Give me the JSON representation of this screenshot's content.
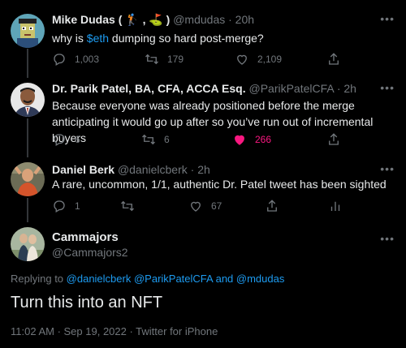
{
  "tweets": [
    {
      "name": "Mike Dudas ( 🏌 , ⛳ )",
      "handle": "@mdudas · 20h",
      "text_before": "why is ",
      "cashtag": "$eth",
      "text_after": " dumping so hard post-merge?",
      "replies": "1,003",
      "retweets": "179",
      "likes": "2,109"
    },
    {
      "name": "Dr. Parik Patel, BA, CFA, ACCA Esq.",
      "handle": "@ParikPatelCFA · 2h",
      "text": "Because everyone was already positioned before the merge anticipating it would go up after so you’ve run out of incremental buyers",
      "replies": "6",
      "retweets": "6",
      "likes": "266"
    },
    {
      "name": "Daniel Berk",
      "handle": "@danielcberk · 2h",
      "text": "A rare, uncommon, 1/1, authentic Dr. Patel tweet has been sighted",
      "replies": "1",
      "retweets": "",
      "likes": "67"
    }
  ],
  "main": {
    "name": "Cammajors",
    "handle": "@Cammajors2",
    "replying_prefix": "Replying to ",
    "mention_1": "@danielcberk",
    "mention_2": "@ParikPatelCFA",
    "and_word": " and ",
    "mention_3": "@mdudas",
    "text": "Turn this into an NFT",
    "meta": "11:02 AM · Sep 19, 2022 · Twitter for iPhone"
  },
  "colors": {
    "link": "#1d9bf0",
    "like": "#f91880",
    "muted": "#71767b"
  }
}
